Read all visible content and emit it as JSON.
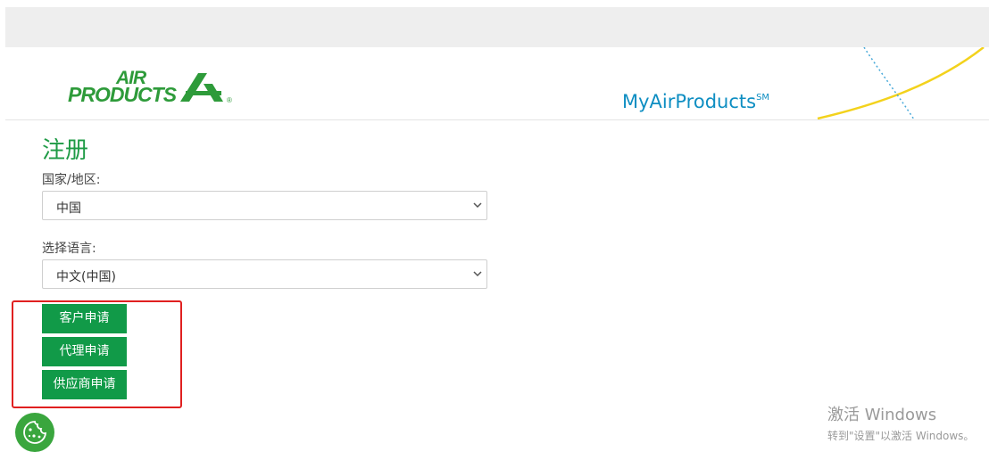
{
  "header": {
    "logo_text_top": "AIR",
    "logo_text_bottom": "PRODUCTS",
    "logo_registered": "®",
    "brand_name": "MyAirProducts",
    "brand_mark": "SM"
  },
  "form": {
    "title": "注册",
    "country_label": "国家/地区:",
    "country_value": "中国",
    "language_label": "选择语言:",
    "language_value": "中文(中国)"
  },
  "actions": {
    "customer_apply": "客户申请",
    "agent_apply": "代理申请",
    "supplier_apply": "供应商申请"
  },
  "cookie_button": {
    "icon": "cookie-icon"
  },
  "watermark": {
    "line1": "激活 Windows",
    "line2": "转到\"设置\"以激活 Windows。"
  },
  "colors": {
    "brand_green": "#119a48",
    "title_green": "#1f9b46",
    "brand_blue": "#0e8ec2",
    "highlight_red": "#e02020",
    "topbar_gray": "#eeeeee"
  }
}
